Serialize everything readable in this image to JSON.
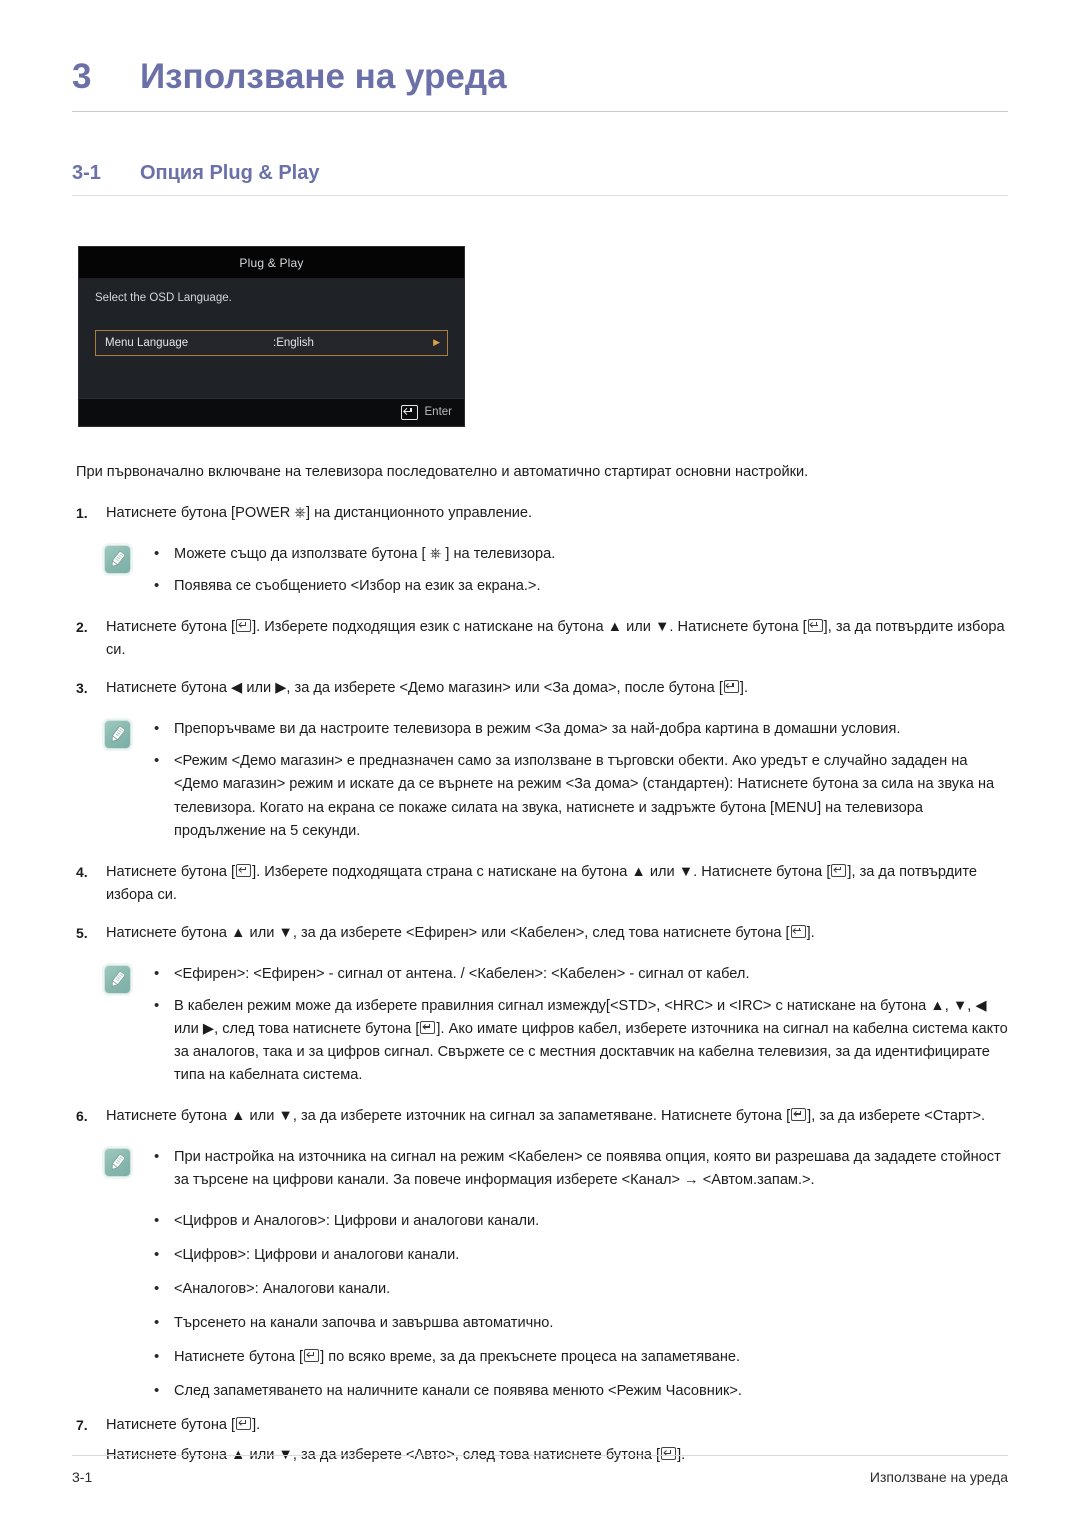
{
  "chapter": {
    "number": "3",
    "title": "Използване на уреда"
  },
  "section": {
    "number": "3-1",
    "title": "Опция Plug & Play"
  },
  "osd": {
    "title": "Plug & Play",
    "prompt": "Select the OSD Language.",
    "row_label": "Menu Language",
    "row_value": ":English",
    "enter_label": "Enter",
    "highlight_color": "#a8803c"
  },
  "intro": "При първоначално включване на телевизора последователно и автоматично стартират основни настройки.",
  "steps": [
    {
      "num": "1.",
      "text_before_icon": "Натиснете бутона [POWER ",
      "icon": "power-icon",
      "text_after_icon": "] на дистанционното управление."
    },
    {
      "num": "2.",
      "part1": "Натиснете бутона [",
      "part2": "]. Изберете подходящия език с натискане на бутона ▲ или ▼. Натиснете бутона [",
      "part3": "], за да потвърдите избора си."
    },
    {
      "num": "3.",
      "part1": "Натиснете бутона ◀ или ▶, за да изберете <Демо магазин> или <За дома>, после бутона [",
      "part2": "]."
    },
    {
      "num": "4.",
      "part1": "Натиснете бутона [",
      "part2": "]. Изберете подходящата страна с натискане на бутона ▲ или ▼. Натиснете бутона [",
      "part3": "], за да потвърдите избора си."
    },
    {
      "num": "5.",
      "part1": "Натиснете бутона ▲ или ▼, за да изберете <Ефирен> или <Кабелен>, след това натиснете бутона [",
      "part2": "]."
    },
    {
      "num": "6.",
      "part1": "Натиснете бутона ▲ или ▼, за да изберете източник на сигнал за запаметяване. Натиснете бутона [",
      "part2": "], за да изберете <Старт>."
    },
    {
      "num": "7.",
      "part1": "Натиснете бутона [",
      "part2": "].",
      "extra1": "Натиснете бутона ▲ или ▼, за да изберете <Авто>, след това натиснете бутона [",
      "extra2": "]."
    }
  ],
  "note1": {
    "icon": "pencil-note-icon",
    "items": [
      {
        "part1": "Можете също да използвате бутона [ ",
        "icon": "power-icon",
        "part2": " ] на телевизора."
      },
      {
        "text": "Появява се съобщението <Избор на език за екрана.>."
      }
    ]
  },
  "note2": {
    "icon": "pencil-note-icon",
    "items": [
      {
        "text": "Препоръчваме ви да настроите телевизора в режим <За дома> за най-добра картина в домашни условия."
      },
      {
        "text": "<Режим <Демо магазин> е предназначен само за използване в търговски обекти. Ако уредът е случайно зададен на <Демо магазин> режим и искате да се върнете на режим <За дома> (стандартен): Натиснете бутона за сила на звука на телевизора. Когато на екрана се покаже силата на звука, натиснете и задръжте бутона [MENU] на телевизора продължение на 5 секунди."
      }
    ]
  },
  "note3": {
    "icon": "pencil-note-icon",
    "items": [
      {
        "text": "<Ефирен>: <Ефирен> - сигнал от антена. / <Кабелен>: <Кабелен> - сигнал от кабел."
      },
      {
        "part1": "В кабелен режим може да изберете правилния сигнал измежду[<STD>, <HRC> и <IRC> с натискане на бутона ▲, ▼, ◀ или ▶, след това натиснете бутона [",
        "part2": "]. Ако имате цифров кабел, изберете източника на сигнал на кабелна система както за аналогов, така и за цифров сигнал. Свържете се с местния досктавчик на кабелна телевизия, за да идентифицирате типа на кабелната система."
      }
    ]
  },
  "note4": {
    "icon": "pencil-note-icon",
    "items": [
      {
        "text": "При настройка на източника на сигнал на режим <Кабелен> се появява опция, която ви разрешава да зададете стойност за търсене на цифрови канали. За повече информация изберете <Канал> → <Автом.запам.>."
      }
    ]
  },
  "sub_bullets": [
    {
      "text": "<Цифров и Аналогов>: Цифрови и аналогови канали."
    },
    {
      "text": "<Цифров>: Цифрови и аналогови канали."
    },
    {
      "text": "<Аналогов>: Аналогови канали."
    },
    {
      "text": "Търсенето на канали започва и завършва автоматично."
    },
    {
      "part1": "Натиснете бутона [",
      "part2": "] по всяко време, за да прекъснете процеса на запаметяване."
    },
    {
      "text": "След запаметяването на наличните канали се появява менюто <Режим Часовник>."
    }
  ],
  "footer": {
    "left": "3-1",
    "right": "Използване на уреда"
  },
  "colors": {
    "heading": "#6b70a8",
    "body_text": "#1c1c1c",
    "note_badge": "#87b7ae",
    "osd_highlight": "#a8803c"
  }
}
